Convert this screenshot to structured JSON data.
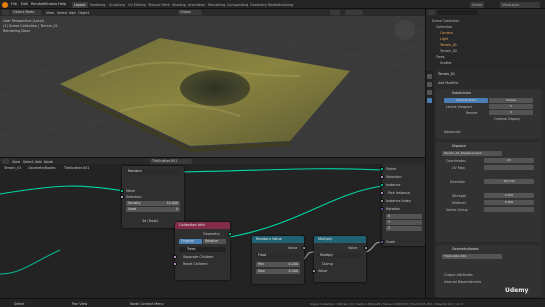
{
  "app": {
    "menus": [
      "File",
      "Edit",
      "Render",
      "Window",
      "Help"
    ],
    "workspaces": [
      "Layout",
      "Modeling",
      "Sculpting",
      "UV Editing",
      "Texture Paint",
      "Shading",
      "Animation",
      "Rendering",
      "Compositing",
      "Geometry Nodes",
      "Scripting"
    ],
    "active_workspace": "Layout",
    "scene": "Scene",
    "view_layer": "ViewLayer"
  },
  "viewport": {
    "mode": "Object Mode",
    "menu": [
      "View",
      "Select",
      "Add",
      "Object"
    ],
    "orientation": "Global",
    "overlay_info": [
      "User Perspective (Local)",
      "(1) Scene Collection | Terrain_01",
      "Rendering Done"
    ]
  },
  "node_editor": {
    "menu": [
      "View",
      "Select",
      "Add",
      "Node"
    ],
    "object": "Terrain_01",
    "modifier": "GeometryNodes",
    "tree": "TileScatter.001",
    "tree_field": "TileScatter.001"
  },
  "nodes": {
    "random": {
      "type": "Random",
      "mesh": "Mesh",
      "selection": "Selection",
      "density_label": "Density",
      "density_value": "10.000",
      "seed_label": "Seed",
      "seed_value": "0",
      "footer": "3d (Hoat)."
    },
    "collection_info": {
      "title": "Collection Info",
      "geometry": "Geometry",
      "btn_original": "Original",
      "btn_relative": "Relative",
      "tree": "Trees",
      "separate": "Separate Children",
      "reset": "Reset Children"
    },
    "random_value": {
      "title": "Random Value",
      "value": "Value",
      "type": "Float",
      "min_label": "Min",
      "min_value": "0.200",
      "max_label": "Max",
      "max_value": "0.300"
    },
    "multiply": {
      "title": "Multiply",
      "value": "Value",
      "op": "Multiply",
      "clamp": "Clamp",
      "value2": "Value"
    },
    "instance": {
      "points": "Points",
      "selection": "Selection",
      "instance": "Instance",
      "pick": "Pick Instance",
      "index": "Instance Index",
      "rotation": "Rotation",
      "x": "X",
      "y": "Y",
      "z": "Z",
      "scale": "Scale"
    }
  },
  "outliner": {
    "title": "Scene Collection",
    "items": [
      "Collection",
      "Camera",
      "Light",
      "Terrain_01",
      "Terrain_02",
      "Trees",
      "Scatter"
    ]
  },
  "properties": {
    "object": "Terrain_01",
    "modifiers_title": "Add Modifier",
    "subdivision": {
      "name": "Subdivision",
      "tabs": [
        "Catmull-Clark",
        "Simple"
      ],
      "levels_viewport_label": "Levels Viewport",
      "levels_viewport": "5",
      "render_label": "Render",
      "render": "6",
      "optimal": "Optimal Display",
      "advanced": "Advanced"
    },
    "displace": {
      "name": "Displace",
      "texture": "Terrain_01_Displacement",
      "coords_label": "Coordinates",
      "coords": "UV",
      "uv_map_label": "UV Map",
      "direction_label": "Direction",
      "direction": "Normal",
      "strength_label": "Strength",
      "strength": "0.450",
      "midlevel_label": "Midlevel",
      "midlevel": "0.500",
      "vgroup_label": "Vertex Group"
    },
    "geonodes": {
      "name": "GeometryNodes",
      "tree": "TileScatter.001",
      "output": "Output Attributes",
      "internal": "Internal Dependencies"
    }
  },
  "status": {
    "items": [
      "Select",
      "Pan View",
      "Node Context Menu"
    ],
    "stats": "Scene Collection | Terrain_01 | Verts:1,056,049 | Faces:1,048,576 | Tris:2,097,152 | Objects:1/3 | 3.1.0"
  },
  "watermark": "Udemy",
  "colors": {
    "group_header": "#3b5268",
    "geo_node_header": "#1e6b5f",
    "collection_header": "#832c49",
    "converter_header": "#1f6274",
    "accent": "#4a7fb5"
  }
}
